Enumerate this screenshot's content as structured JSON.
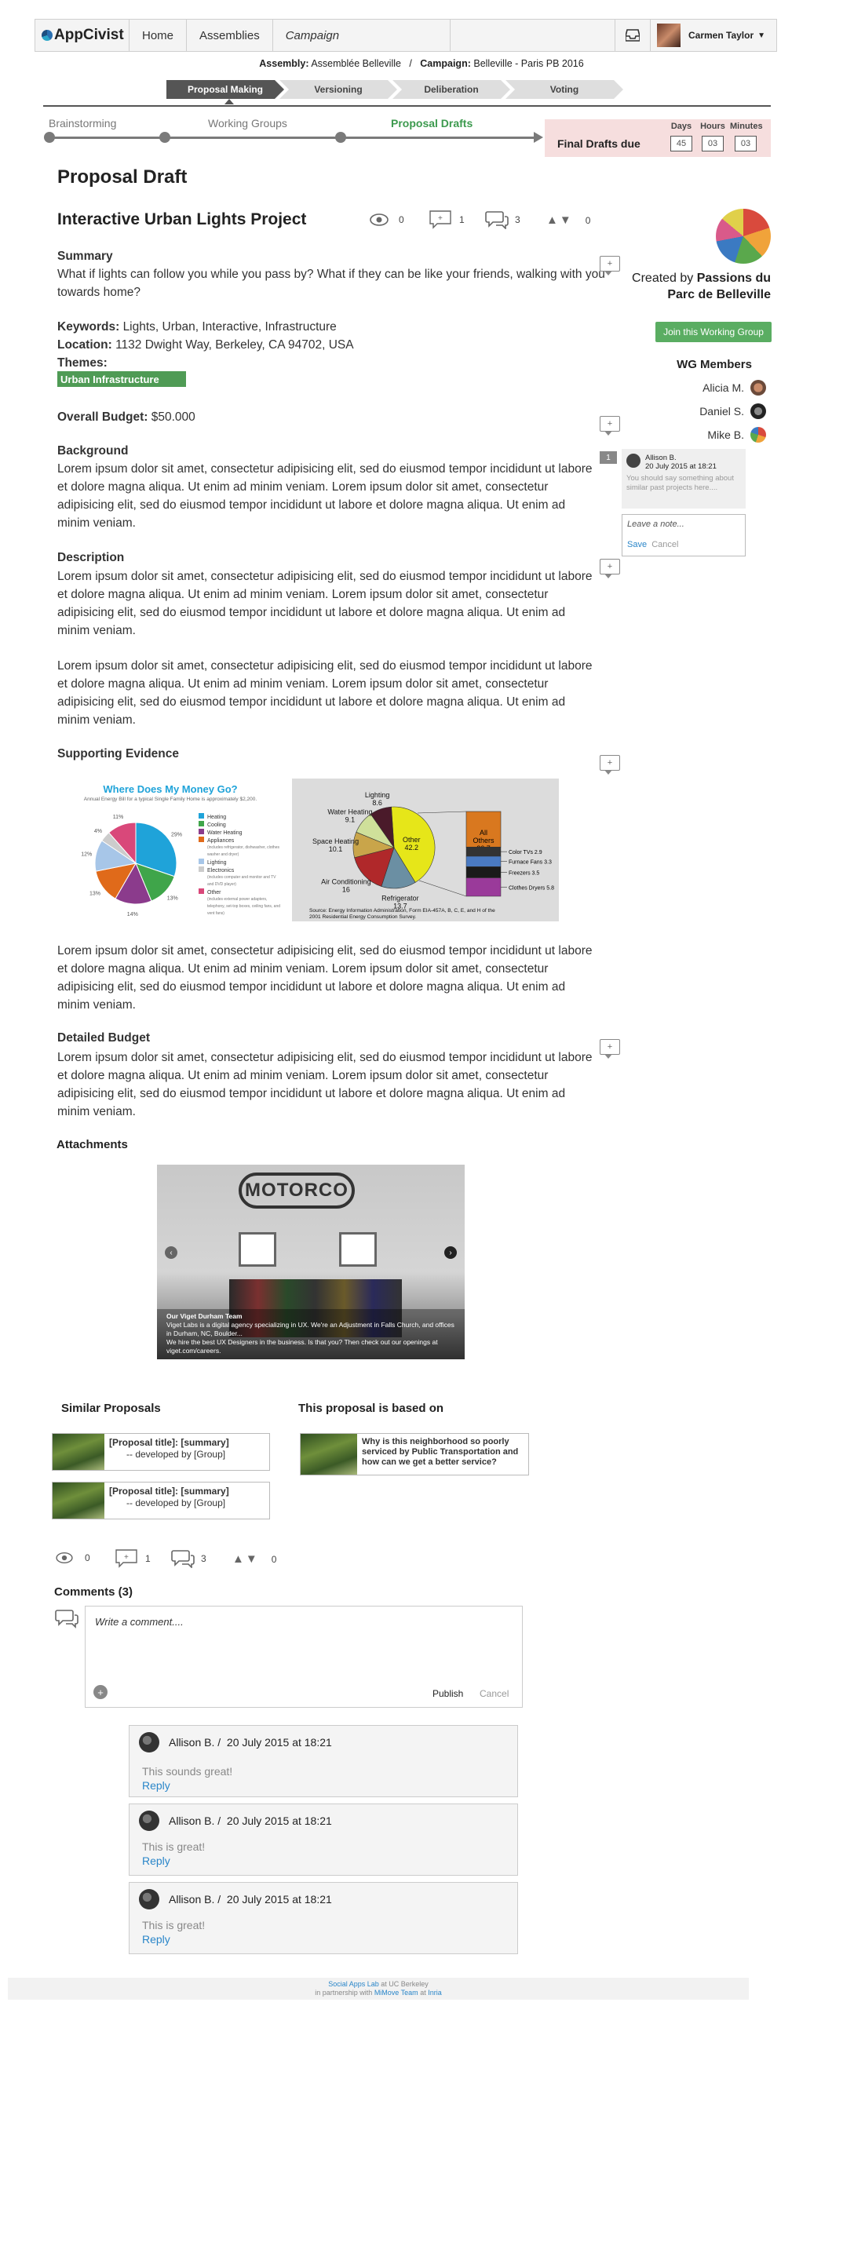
{
  "header": {
    "brand": "AppCivist",
    "nav": [
      "Home",
      "Assemblies",
      "Campaign"
    ],
    "user_name": "Carmen Taylor"
  },
  "assembly": {
    "assembly_label": "Assembly:",
    "assembly_value": "Assemblée Belleville",
    "separator": "/",
    "campaign_label": "Campaign:",
    "campaign_value": "Belleville - Paris PB 2016"
  },
  "phases": [
    "Proposal Making",
    "Versioning",
    "Deliberation",
    "Voting"
  ],
  "timeline": {
    "stages": [
      "Brainstorming",
      "Working Groups",
      "Proposal Drafts"
    ],
    "due_label": "Final Drafts due",
    "units": [
      "Days",
      "Hours",
      "Minutes"
    ],
    "values": [
      "45",
      "03",
      "03"
    ]
  },
  "page_title": "Proposal Draft",
  "proposal": {
    "title": "Interactive Urban Lights Project",
    "views": "0",
    "notes": "1",
    "comments": "3",
    "votes": "0",
    "summary_heading": "Summary",
    "summary": "What if lights can follow you while you pass by? What if they can be like your friends, walking with you towards home?",
    "keywords_label": "Keywords:",
    "keywords": "Lights, Urban, Interactive, Infrastructure",
    "location_label": "Location:",
    "location": "1132 Dwight Way, Berkeley, CA 94702, USA",
    "themes_label": "Themes:",
    "theme": "Urban Infrastructure",
    "budget_label": "Overall Budget:",
    "budget": "$50.000",
    "background_heading": "Background",
    "lorem": "Lorem ipsum dolor sit amet, consectetur adipisicing elit, sed do eiusmod tempor incididunt ut labore et dolore magna aliqua. Ut enim ad minim veniam. Lorem ipsum dolor sit amet, consectetur adipisicing elit, sed do eiusmod tempor incididunt ut labore et dolore magna aliqua. Ut enim ad minim veniam.",
    "description_heading": "Description",
    "evidence_heading": "Supporting Evidence",
    "detailed_budget_heading": "Detailed Budget",
    "attachments_heading": "Attachments"
  },
  "sidebar": {
    "created_by_prefix": "Created by",
    "group_name": "Passions du Parc de Belleville",
    "join_label": "Join this Working Group",
    "members_title": "WG Members",
    "members": [
      "Alicia M.",
      "Daniel S.",
      "Mike B."
    ],
    "note": {
      "count": "1",
      "author": "Allison B.",
      "date": "20 July 2015 at 18:21",
      "text": "You should say something about similar past projects here...."
    },
    "note_input": {
      "placeholder": "Leave a note...",
      "save": "Save",
      "cancel": "Cancel"
    }
  },
  "chart1": {
    "title": "Where Does My Money Go?",
    "subtitle": "Annual Energy Bill for a typical Single Family Home is approximately $2,200.",
    "legend": [
      "Heating",
      "Cooling",
      "Water Heating",
      "Appliances",
      "Lighting",
      "Electronics",
      "Other"
    ],
    "appliances_note": "(includes refrigerator, dishwasher, clothes washer and dryer)",
    "electronics_note": "(includes computer and monitor and TV and DVD player)",
    "other_note": "(includes external power adapters, telephony, set-top boxes, ceiling fans, and vent fans)",
    "pct_labels": [
      "11%",
      "4%",
      "12%",
      "13%",
      "14%",
      "13%",
      "29%"
    ],
    "colors": [
      "#1fa3d9",
      "#3fa54a",
      "#8b3b8c",
      "#e06a1a",
      "#a7c6e8",
      "#cccccc",
      "#d9487a"
    ],
    "values": [
      29,
      13,
      14,
      13,
      12,
      4,
      11
    ]
  },
  "chart_data": {
    "type": "pie",
    "slices": [
      {
        "label": "Other",
        "value": 42.2
      },
      {
        "label": "Refrigerator",
        "value": 13.7
      },
      {
        "label": "Air Conditioning",
        "value": 16
      },
      {
        "label": "Space Heating",
        "value": 10.1
      },
      {
        "label": "Water Heating",
        "value": 9.1
      },
      {
        "label": "Lighting",
        "value": 8.6
      }
    ],
    "breakdown": {
      "label": "All Others",
      "value": 26.7,
      "items": [
        {
          "label": "Color TVs",
          "value": 2.9
        },
        {
          "label": "Furnace Fans",
          "value": 3.3
        },
        {
          "label": "Freezers",
          "value": 3.5
        },
        {
          "label": "Clothes Dryers",
          "value": 5.8
        }
      ]
    },
    "colors": [
      "#e6e619",
      "#6b8fa3",
      "#b0282a",
      "#c9a54a",
      "#cfe09a",
      "#4a1a2a"
    ],
    "source": "Source: Energy Information Administration, Form EIA-457A, B, C, E, and H of the 2001 Residential Energy Consumption Survey."
  },
  "attachment": {
    "sign": "MOTORCO",
    "caption_title": "Our Viget Durham Team",
    "caption_text": "Viget Labs is a digital agency specializing in UX. We're an Adjustment in Falls Church, and offices in Durham, NC, Boulder...",
    "caption_more": "We hire the best UX Designers in the business. Is that you? Then check out our openings at viget.com/careers."
  },
  "similar": {
    "heading": "Similar Proposals",
    "items": [
      {
        "title": "[Proposal title]: [summary]",
        "by": "-- developed by [Group]"
      },
      {
        "title": "[Proposal title]: [summary]",
        "by": "-- developed by [Group]"
      }
    ]
  },
  "based_on": {
    "heading": "This proposal is based on",
    "item": "Why is this neighborhood so poorly serviced by Public Transportation and how can we get a better service?"
  },
  "stats2": {
    "views": "0",
    "notes": "1",
    "comments": "3",
    "votes": "0"
  },
  "comments": {
    "heading": "Comments (3)",
    "placeholder": "Write a comment....",
    "publish": "Publish",
    "cancel": "Cancel",
    "items": [
      {
        "author": "Allison B.",
        "sep": "/",
        "date": "20 July 2015 at 18:21",
        "text": "This sounds great!",
        "reply": "Reply"
      },
      {
        "author": "Allison B.",
        "sep": "/",
        "date": "20 July 2015 at 18:21",
        "text": "This is great!",
        "reply": "Reply"
      },
      {
        "author": "Allison B.",
        "sep": "/",
        "date": "20 July 2015 at 18:21",
        "text": "This is great!",
        "reply": "Reply"
      }
    ]
  },
  "footer": {
    "lab": "Social Apps Lab",
    "at": "at UC Berkeley",
    "partner": "in partnership with",
    "team": "MiMove Team",
    "at2": "at",
    "inria": "Inria"
  }
}
